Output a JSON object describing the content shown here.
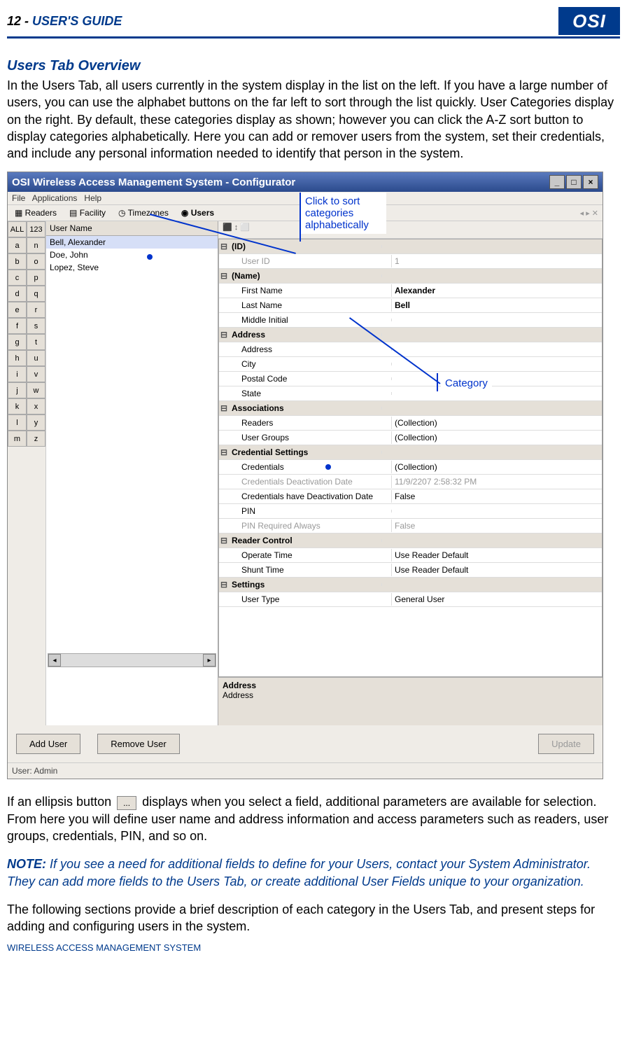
{
  "header": {
    "page_num": "12 - ",
    "guide": "USER'S GUIDE",
    "logo": "OSI"
  },
  "title": "Users Tab Overview",
  "para1": "In the Users Tab, all users currently in the system display in the list on the left.   If you have a large number of users, you can use the alphabet buttons on the far left to sort through the list quickly.   User Categories display on the right.   By default, these categories display as shown; however you can click the A-Z sort button to display categories alphabetically.   Here you can add or remover users from the system, set their credentials, and include any personal information needed to identify that person in the system.",
  "app": {
    "title": "OSI Wireless Access Management System - Configurator",
    "menu_file": "File",
    "menu_apps": "Applications",
    "menu_help": "Help",
    "tab_readers": "Readers",
    "tab_facility": "Facility",
    "tab_timezones": "Timezones",
    "tab_users": "Users",
    "az_all": "ALL",
    "az_123": "123",
    "az_left": [
      "a",
      "b",
      "c",
      "d",
      "e",
      "f",
      "g",
      "h",
      "i",
      "j",
      "k",
      "l",
      "m"
    ],
    "az_right": [
      "n",
      "o",
      "p",
      "q",
      "r",
      "s",
      "t",
      "u",
      "v",
      "w",
      "x",
      "y",
      "z"
    ],
    "ul_header": "User Name",
    "ul_users": [
      "Bell, Alexander",
      "Doe, John",
      "Lopez, Steve"
    ],
    "prop_toolbar": "⬛ ↕ ⬜",
    "cat_id": "(ID)",
    "lab_userid": "User ID",
    "val_userid": "1",
    "cat_name": "(Name)",
    "lab_fname": "First Name",
    "val_fname": "Alexander",
    "lab_lname": "Last Name",
    "val_lname": "Bell",
    "lab_mi": "Middle Initial",
    "cat_addr": "Address",
    "lab_addr": "Address",
    "lab_city": "City",
    "lab_pc": "Postal Code",
    "lab_state": "State",
    "cat_assoc": "Associations",
    "lab_readers": "Readers",
    "val_readers": "(Collection)",
    "lab_ugroups": "User Groups",
    "val_ugroups": "(Collection)",
    "cat_cred": "Credential Settings",
    "lab_creds": "Credentials",
    "val_creds": "(Collection)",
    "lab_deact": "Credentials Deactivation Date",
    "val_deact": "11/9/2207 2:58:32 PM",
    "lab_hasdeact": "Credentials have Deactivation Date",
    "val_hasdeact": "False",
    "lab_pin": "PIN",
    "lab_pinreq": "PIN Required Always",
    "val_pinreq": "False",
    "cat_rc": "Reader Control",
    "lab_optime": "Operate Time",
    "val_optime": "Use Reader Default",
    "lab_shunt": "Shunt Time",
    "val_shunt": "Use Reader Default",
    "cat_set": "Settings",
    "lab_utype": "User Type",
    "val_utype": "General User",
    "desc_title": "Address",
    "desc_sub": "Address",
    "btn_add": "Add User",
    "btn_remove": "Remove User",
    "btn_update": "Update",
    "status": "User: Admin"
  },
  "annot1": "Click to sort categories alphabetically",
  "annot2": "Category",
  "para2a": "If an ellipsis button ",
  "para2b": " displays when you select a field, additional parameters are available for selection. From here you will define user name and address information and access parameters such as readers, user groups, credentials, PIN, and so on.",
  "ellipsis": "...",
  "note_label": "NOTE:",
  "note_text": "   If you see a need for additional fields to define for your Users, contact your System Administrator.   They can add more fields to the Users Tab, or create additional User Fields unique to your organization.",
  "para3": "The following sections provide a brief description of each category in the Users Tab, and present steps for adding and configuring users in the system.",
  "footer": "WIRELESS ACCESS MANAGEMENT SYSTEM"
}
